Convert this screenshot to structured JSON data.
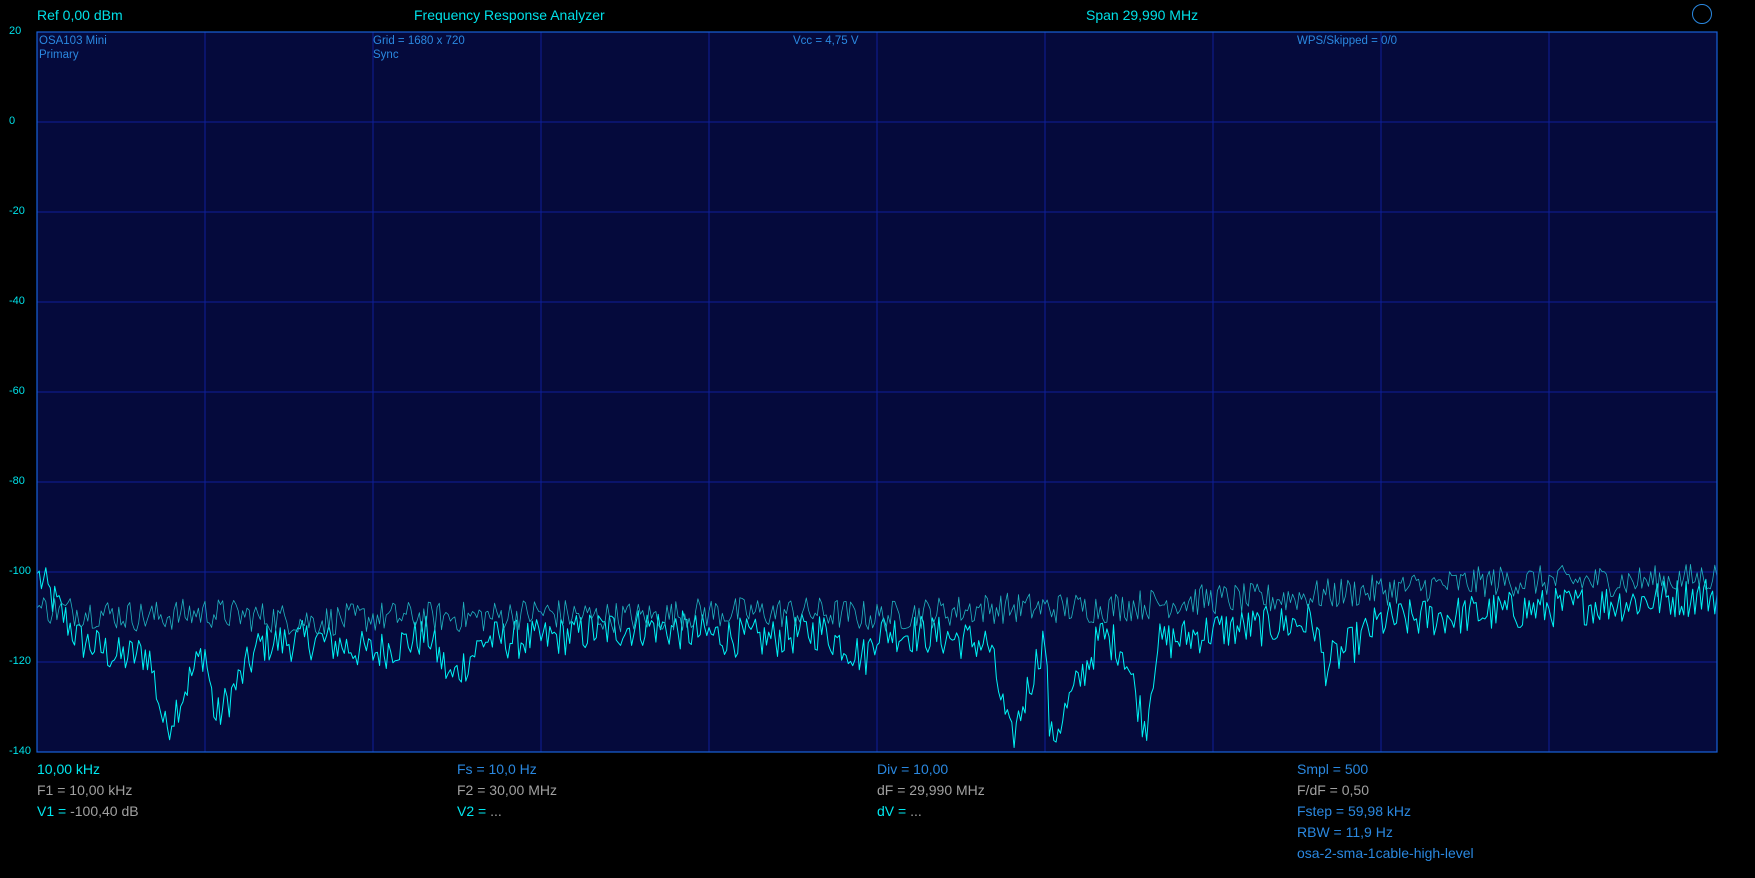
{
  "header": {
    "ref": "Ref  0,00 dBm",
    "title": "Frequency Response Analyzer",
    "span": "Span 29,990 MHz"
  },
  "info": {
    "device": "OSA103 Mini",
    "mode": "Primary",
    "grid": "Grid = 1680 x 720",
    "sync": "Sync",
    "vcc": "Vcc = 4,75 V",
    "wps": "WPS/Skipped  = 0/0"
  },
  "footer": {
    "col1": {
      "freq": "10,00 kHz",
      "f1": "F1 = 10,00 kHz",
      "v1_key": "V1 =",
      "v1_val": " -100,40 dB"
    },
    "col2": {
      "fs": "Fs = 10,0 Hz",
      "f2": "F2 = 30,00 MHz",
      "v2_key": "V2 =",
      "v2_val": " ..."
    },
    "col3": {
      "div": "Div = 10,00",
      "df": "dF = 29,990 MHz",
      "dv_key": "dV =",
      "dv_val": " ..."
    },
    "col4": {
      "smpl": "Smpl = 500",
      "fdf": "F/dF = 0,50",
      "fstep": "Fstep = 59,98 kHz",
      "rbw": "RBW = 11,9 Hz",
      "profile": "osa-2-sma-1cable-high-level"
    }
  },
  "colors": {
    "background": "#000000",
    "plot_background": "#050a3c",
    "grid": "#0e1f9a",
    "frame": "#1860d8",
    "trace_primary": "#00f4f4",
    "trace_secondary": "#20b4c0",
    "label_cyan": "#00e0e8",
    "label_blue": "#2a88e0",
    "label_gray": "#a0a0a0"
  },
  "chart_data": {
    "type": "line",
    "title": "",
    "xlabel": "",
    "ylabel": "",
    "xlim": [
      0.01,
      30.0
    ],
    "ylim": [
      -140,
      20
    ],
    "y_ticks": [
      20,
      0,
      -20,
      -40,
      -60,
      -80,
      -100,
      -120,
      -140
    ],
    "x_divisions": 10,
    "grid": true,
    "legend": "none",
    "series": [
      {
        "x": [
          0.01,
          0.75,
          1.5,
          2.0,
          2.3,
          3.0,
          3.2,
          4.0,
          5.0,
          6.0,
          7.0,
          7.4,
          8.0,
          9.0,
          10.0,
          11.0,
          12.0,
          13.0,
          14.0,
          14.8,
          15.0,
          16.0,
          17.0,
          17.4,
          18.0,
          18.1,
          19.0,
          19.4,
          19.8,
          20.0,
          21.0,
          22.0,
          22.8,
          23.0,
          24.0,
          25.0,
          26.0,
          27.0,
          28.0,
          29.0,
          30.0
        ],
        "values": [
          -100.4,
          -115,
          -119,
          -118,
          -135,
          -117,
          -133,
          -116,
          -115,
          -118,
          -114,
          -124,
          -115,
          -115,
          -113,
          -112,
          -114,
          -115,
          -113,
          -119,
          -113,
          -114,
          -116,
          -138,
          -114,
          -138,
          -114,
          -117,
          -135,
          -116,
          -113,
          -112,
          -111,
          -121,
          -111,
          -110,
          -109,
          -108,
          -107,
          -106,
          -105
        ]
      },
      {
        "x": [
          0.01,
          1.0,
          2.0,
          3.0,
          4.0,
          5.0,
          6.0,
          7.0,
          8.0,
          9.0,
          10.0,
          11.0,
          12.0,
          13.0,
          14.0,
          15.0,
          16.0,
          17.0,
          18.0,
          19.0,
          20.0,
          21.0,
          22.0,
          23.0,
          24.0,
          25.0,
          26.0,
          27.0,
          28.0,
          29.0,
          30.0
        ],
        "values": [
          -108,
          -109,
          -110,
          -109,
          -110,
          -111,
          -110,
          -110,
          -110,
          -109,
          -110,
          -110,
          -109,
          -109,
          -109,
          -110,
          -109,
          -108,
          -108,
          -108,
          -107,
          -106,
          -106,
          -105,
          -104,
          -103,
          -102,
          -102,
          -102,
          -102,
          -101
        ]
      }
    ]
  }
}
